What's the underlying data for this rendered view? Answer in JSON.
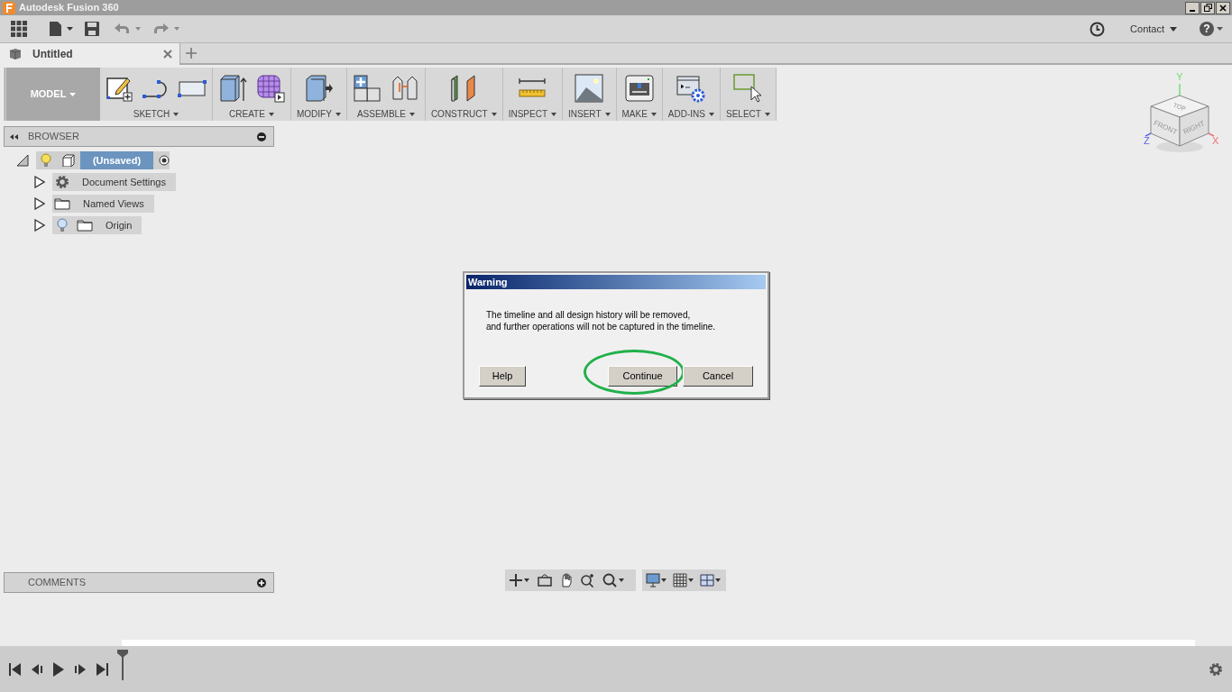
{
  "window": {
    "title": "Autodesk Fusion 360"
  },
  "top_bar": {
    "contact": "Contact",
    "help": "?"
  },
  "tabs": [
    {
      "label": "Untitled",
      "selected": true
    }
  ],
  "toolbar": {
    "workspace": "MODEL",
    "groups": [
      {
        "label": "SKETCH",
        "kind": "sketch"
      },
      {
        "label": "CREATE",
        "kind": "create"
      },
      {
        "label": "MODIFY",
        "kind": "modify"
      },
      {
        "label": "ASSEMBLE",
        "kind": "assemble"
      },
      {
        "label": "CONSTRUCT",
        "kind": "construct"
      },
      {
        "label": "INSPECT",
        "kind": "inspect"
      },
      {
        "label": "INSERT",
        "kind": "insert"
      },
      {
        "label": "MAKE",
        "kind": "make"
      },
      {
        "label": "ADD-INS",
        "kind": "addins"
      },
      {
        "label": "SELECT",
        "kind": "select"
      }
    ]
  },
  "view_cube": {
    "top": "TOP",
    "front": "FRONT",
    "right": "RIGHT",
    "x": "X",
    "y": "Y",
    "z": "Z"
  },
  "browser": {
    "title": "BROWSER",
    "root": {
      "label": "(Unsaved)",
      "expanded": true,
      "selected": true,
      "children": [
        {
          "label": "Document Settings",
          "kind": "settings",
          "expanded": false,
          "selected": false
        },
        {
          "label": "Named Views",
          "kind": "folder",
          "expanded": false,
          "selected": false
        },
        {
          "label": "Origin",
          "kind": "origin",
          "expanded": false,
          "selected": false
        }
      ]
    }
  },
  "dialog": {
    "title": "Warning",
    "message": [
      "The timeline and all design history will be removed,",
      "and further operations will not be captured in the timeline."
    ],
    "buttons": [
      {
        "label": "Help",
        "highlighted": false
      },
      {
        "label": "Continue",
        "highlighted": true
      },
      {
        "label": "Cancel",
        "highlighted": false
      }
    ]
  },
  "comments": {
    "title": "COMMENTS"
  }
}
